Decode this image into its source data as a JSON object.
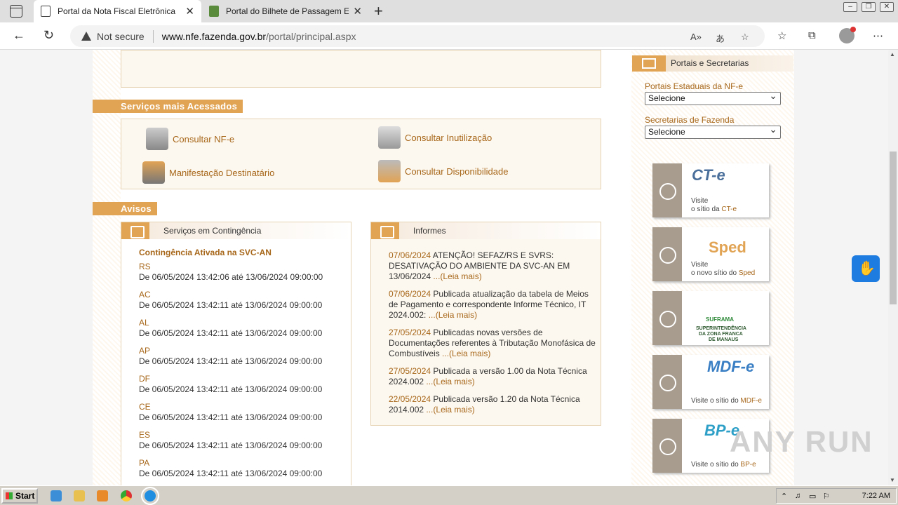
{
  "browser": {
    "tabs": [
      {
        "title": "Portal da Nota Fiscal Eletrônica",
        "close": "✕"
      },
      {
        "title": "Portal do Bilhete de Passagem Ele",
        "close": "✕"
      }
    ],
    "new_tab": "+",
    "security": "Not secure",
    "url_host": "www.nfe.fazenda.gov.br",
    "url_path": "/portal/principal.aspx"
  },
  "page": {
    "services_header": "Serviços mais Acessados",
    "services": [
      {
        "label": "Consultar NF-e"
      },
      {
        "label": "Consultar Inutilização"
      },
      {
        "label": "Manifestação Destinatário"
      },
      {
        "label": "Consultar Disponibilidade"
      }
    ],
    "avisos_header": "Avisos",
    "contingencia": {
      "title": "Serviços em Contingência",
      "subtitle": "Contingência Ativada na SVC-AN",
      "items": [
        {
          "state": "RS",
          "period": "De 06/05/2024 13:42:06 até 13/06/2024 09:00:00"
        },
        {
          "state": "AC",
          "period": "De 06/05/2024 13:42:11 até 13/06/2024 09:00:00"
        },
        {
          "state": "AL",
          "period": "De 06/05/2024 13:42:11 até 13/06/2024 09:00:00"
        },
        {
          "state": "AP",
          "period": "De 06/05/2024 13:42:11 até 13/06/2024 09:00:00"
        },
        {
          "state": "DF",
          "period": "De 06/05/2024 13:42:11 até 13/06/2024 09:00:00"
        },
        {
          "state": "CE",
          "period": "De 06/05/2024 13:42:11 até 13/06/2024 09:00:00"
        },
        {
          "state": "ES",
          "period": "De 06/05/2024 13:42:11 até 13/06/2024 09:00:00"
        },
        {
          "state": "PA",
          "period": "De 06/05/2024 13:42:11 até 13/06/2024 09:00:00"
        }
      ]
    },
    "informes": {
      "title": "Informes",
      "items": [
        {
          "date": "07/06/2024",
          "text": " ATENÇÃO! SEFAZ/RS E SVRS: DESATIVAÇÃO DO AMBIENTE DA SVC-AN EM 13/06/2024 ",
          "more": "...(Leia mais)"
        },
        {
          "date": "07/06/2024",
          "text": " Publicada atualização da tabela de Meios de Pagamento e correspondente Informe Técnico, IT 2024.002: ",
          "more": "...(Leia mais)"
        },
        {
          "date": "27/05/2024",
          "text": " Publicadas novas versões de Documentações referentes à Tributação Monofásica de Combustíveis ",
          "more": "...(Leia mais)"
        },
        {
          "date": "27/05/2024",
          "text": " Publicada a versão 1.00 da Nota Técnica 2024.002 ",
          "more": "...(Leia mais)"
        },
        {
          "date": "22/05/2024",
          "text": " Publicada versão 1.20 da Nota Técnica 2014.002 ",
          "more": "...(Leia mais)"
        }
      ]
    },
    "portais": {
      "title": "Portais e Secretarias",
      "label_estaduais": "Portais Estaduais da NF-e",
      "select_estaduais": "Selecione",
      "label_secretarias": "Secretarias de Fazenda",
      "select_secretarias": "Selecione"
    },
    "banners": [
      {
        "logo": "CT-e",
        "cap_prefix": "Visite",
        "cap_line2": "o sítio da ",
        "cap_brand": "CT-e"
      },
      {
        "logo": "Sped",
        "cap_prefix": "Visite",
        "cap_line2": "o novo sítio do ",
        "cap_brand": "Sped"
      },
      {
        "logo": "SUFRAMA",
        "line1": "SUPERINTENDÊNCIA",
        "line2": "DA ZONA FRANCA",
        "line3": "DE MANAUS"
      },
      {
        "logo": "MDF-e",
        "cap_line2": "Visite o sítio do ",
        "cap_brand": "MDF-e"
      },
      {
        "logo": "BP-e",
        "cap_line2": "Visite o sítio do ",
        "cap_brand": "BP-e"
      }
    ]
  },
  "taskbar": {
    "start": "Start",
    "time": "7:22 AM"
  },
  "watermark": "ANY RUN"
}
